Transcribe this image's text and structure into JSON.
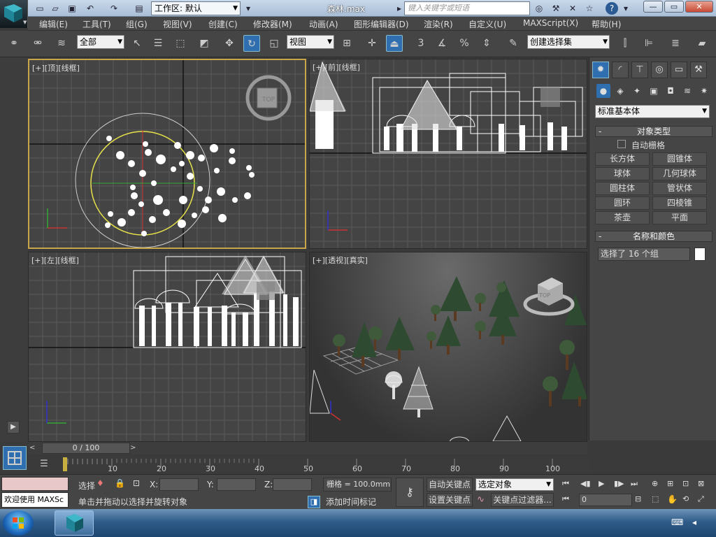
{
  "titlebar": {
    "workspace_label": "工作区: 默认",
    "file_title": "森林.max",
    "search_placeholder": "键入关键字或短语"
  },
  "menubar": {
    "items": [
      "编辑(E)",
      "工具(T)",
      "组(G)",
      "视图(V)",
      "创建(C)",
      "修改器(M)",
      "动画(A)",
      "图形编辑器(D)",
      "渲染(R)",
      "自定义(U)",
      "MAXScript(X)",
      "帮助(H)"
    ]
  },
  "toolbar": {
    "selection_filter": "全部",
    "ref_coord": "视图",
    "snap_num": "3",
    "named_selection_placeholder": "创建选择集"
  },
  "viewports": {
    "top": {
      "label": "[+][顶][线框]"
    },
    "front": {
      "label": "[+][前][线框]"
    },
    "left": {
      "label": "[+][左][线框]"
    },
    "persp": {
      "label": "[+][透视][真实]"
    }
  },
  "command_panel": {
    "category": "标准基本体",
    "object_type_title": "对象类型",
    "autogrid_label": "自动栅格",
    "object_buttons": [
      "长方体",
      "圆锥体",
      "球体",
      "几何球体",
      "圆柱体",
      "管状体",
      "圆环",
      "四棱锥",
      "茶壶",
      "平面"
    ],
    "name_color_title": "名称和颜色",
    "name_value": "选择了 16 个组"
  },
  "timeline": {
    "frame_display": "0 / 100",
    "ticks": [
      "10",
      "20",
      "30",
      "40",
      "50",
      "60",
      "70",
      "80",
      "90",
      "100"
    ]
  },
  "statusbar": {
    "welcome": "欢迎使用 MAXSc",
    "select_label": "选择",
    "x_label": "X:",
    "y_label": "Y:",
    "z_label": "Z:",
    "grid_label": "栅格 = 100.0mm",
    "prompt": "单击并拖动以选择并旋转对象",
    "add_time_tag": "添加时间标记",
    "auto_key": "自动关键点",
    "set_key": "设置关键点",
    "key_mode": "选定对象",
    "key_filters": "关键点过滤器...",
    "frame_value": "0"
  },
  "colors": {
    "viewport_bg": "#444444",
    "active_border": "#c8a44a",
    "accent": "#2f6fb0"
  }
}
